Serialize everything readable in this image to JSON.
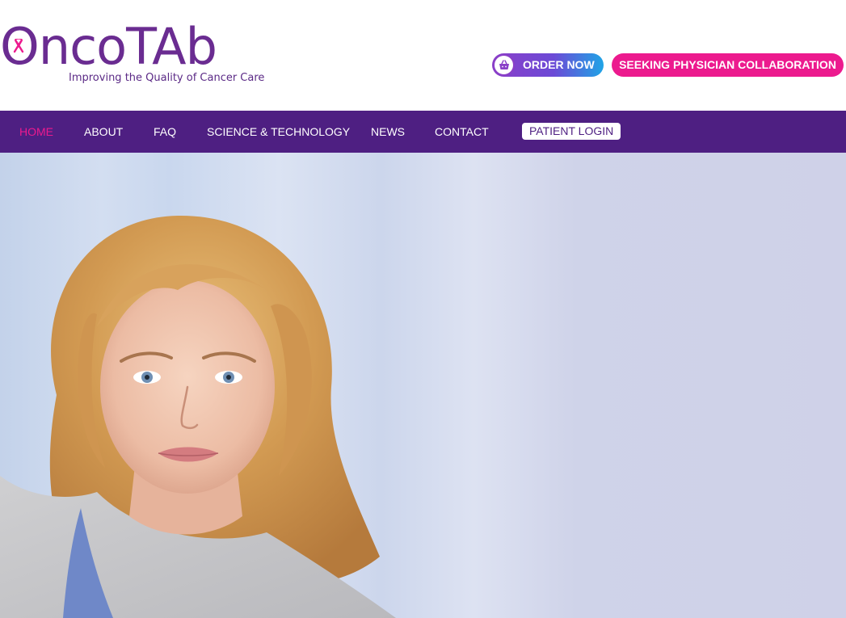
{
  "header": {
    "logo": {
      "wordmark": "OncoTAb",
      "tagline": "Improving the Quality of Cancer Care",
      "ribbon_color": "#ec1a8e"
    },
    "order_button": {
      "label": "ORDER NOW",
      "icon": "shopping-basket-icon"
    },
    "seek_button": {
      "label": "SEEKING PHYSICIAN COLLABORATION"
    }
  },
  "nav": {
    "items": [
      {
        "label": "HOME",
        "active": true
      },
      {
        "label": "ABOUT",
        "active": false
      },
      {
        "label": "FAQ",
        "active": false
      },
      {
        "label": "SCIENCE & TECHNOLOGY",
        "active": false
      },
      {
        "label": "NEWS",
        "active": false
      },
      {
        "label": "CONTACT",
        "active": false
      }
    ],
    "login_label": "PATIENT LOGIN"
  },
  "colors": {
    "brand_purple": "#4e1f82",
    "logo_purple": "#6a2c91",
    "accent_pink": "#ec1a8e",
    "accent_blue": "#1fa4e6"
  },
  "hero": {
    "image": "smiling-blonde-woman-portrait"
  }
}
